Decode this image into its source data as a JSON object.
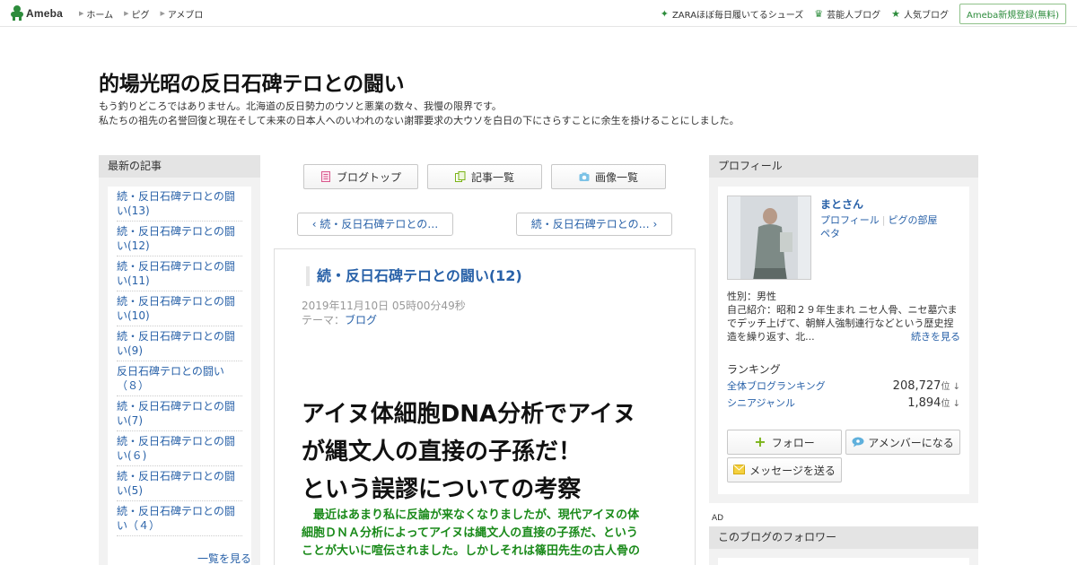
{
  "topbar": {
    "logo_text": "Ameba",
    "nav": [
      "ホーム",
      "ピグ",
      "アメブロ"
    ],
    "right_links": [
      {
        "icon": "sparkle-icon",
        "label": "ZARAほぼ毎日履いてるシューズ"
      },
      {
        "icon": "crown-icon",
        "label": "芸能人ブログ"
      },
      {
        "icon": "star-icon",
        "label": "人気ブログ"
      }
    ],
    "register_label": "Ameba新規登録(無料)",
    "accent_color": "#2d8c3c"
  },
  "header": {
    "title": "的場光昭の反日石碑テロとの闘い",
    "description_line1": "もう釣りどころではありません。北海道の反日勢力のウソと悪業の数々、我慢の限界です。",
    "description_line2": "私たちの祖先の名誉回復と現在そして未来の日本人へのいわれのない謝罪要求の大ウソを白日の下にさらすことに余生を掛けることにしました。"
  },
  "left_panel": {
    "heading": "最新の記事",
    "articles": [
      "続・反日石碑テロとの闘い(13)",
      "続・反日石碑テロとの闘い(12)",
      "続・反日石碑テロとの闘い(11)",
      "続・反日石碑テロとの闘い(10)",
      "続・反日石碑テロとの闘い(9)",
      "反日石碑テロとの闘い（８）",
      "続・反日石碑テロとの闘い(7)",
      "続・反日石碑テロとの闘い(６)",
      "続・反日石碑テロとの闘い(5)",
      "続・反日石碑テロとの闘い（４）"
    ],
    "more_label": "一覧を見る"
  },
  "center": {
    "tabs": [
      {
        "icon": "blog-top-icon",
        "label": "ブログトップ"
      },
      {
        "icon": "article-list-icon",
        "label": "記事一覧"
      },
      {
        "icon": "camera-icon",
        "label": "画像一覧"
      }
    ],
    "prev_label": "続・反日石碑テロとの…",
    "next_label": "続・反日石碑テロとの…",
    "article": {
      "title": "続・反日石碑テロとの闘い(12)",
      "date": "2019年11月10日 05時00分49秒",
      "theme_prefix": "テーマ：",
      "theme": "ブログ",
      "headline_line1": "アイヌ体細胞DNA分析でアイヌ",
      "headline_line2": "が縄文人の直接の子孫だ！",
      "headline_line3": "という誤謬についての考察",
      "lead_line1": "　最近はあまり私に反論が来なくなりましたが、現代アイヌの体",
      "lead_line2": "細胞ＤＮＡ分析によってアイヌは縄文人の直接の子孫だ、という",
      "lead_line3": "ことが大いに喧伝されました。しかしそれは篠田先生の古人骨の",
      "lead_color": "#1a8a1a"
    }
  },
  "profile": {
    "heading": "プロフィール",
    "name": "まとさん",
    "link_profile": "プロフィール",
    "link_pig_room": "ピグの部屋",
    "link_peta": "ペタ",
    "gender": "性別：男性",
    "intro": "自己紹介：昭和２９年生まれ ニセ人骨、ニセ墓穴までデッチ上げて、朝鮮人強制連行などという歴史捏造を繰り返す、北...",
    "more_label": "続きを見る",
    "ranking_heading": "ランキング",
    "ranking": [
      {
        "label": "全体ブログランキング",
        "value": "208,727",
        "unit": "位 ↓"
      },
      {
        "label": "シニアジャンル",
        "value": "1,894",
        "unit": "位 ↓"
      }
    ],
    "follow_label": "フォロー",
    "amember_label": "アメンバーになる",
    "message_label": "メッセージを送る"
  },
  "ad_label": "AD",
  "followers_heading": "このブログのフォロワー"
}
